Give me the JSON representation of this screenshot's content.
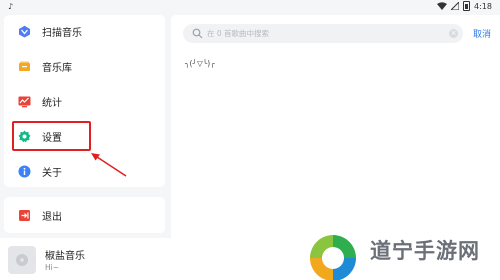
{
  "status_bar": {
    "time": "4:18",
    "left_icon": "music-note-icon"
  },
  "sidebar": {
    "items": [
      {
        "label": "扫描音乐",
        "icon": "scan-icon",
        "color": "#4f7cf3"
      },
      {
        "label": "音乐库",
        "icon": "library-icon",
        "color": "#f5a623"
      },
      {
        "label": "统计",
        "icon": "stats-icon",
        "color": "#e8443a"
      },
      {
        "label": "设置",
        "icon": "gear-icon",
        "color": "#12b886"
      },
      {
        "label": "关于",
        "icon": "info-icon",
        "color": "#3b82f6"
      }
    ],
    "logout": {
      "label": "退出",
      "icon": "logout-icon",
      "color": "#e8443a"
    }
  },
  "search": {
    "placeholder": "在 0 首歌曲中搜索",
    "cancel_label": "取消"
  },
  "main": {
    "empty_text": "╮(╯▽╰)╭"
  },
  "player": {
    "title": "椒盐音乐",
    "subtitle": "Hi~"
  },
  "watermark": {
    "text": "道宁手游网"
  },
  "annotation": {
    "highlight_color": "#e02020"
  }
}
